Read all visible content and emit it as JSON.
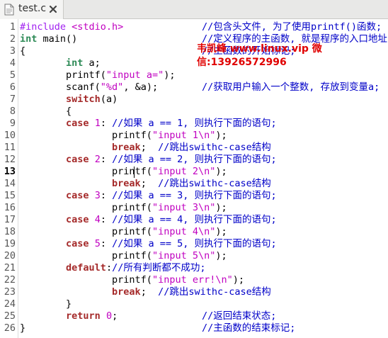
{
  "tab": {
    "filename": "test.c",
    "icon": "text-file-icon",
    "close_icon": "close-icon"
  },
  "lines": [
    {
      "n": "1",
      "code": [
        {
          "t": "#include ",
          "c": "pp"
        },
        {
          "t": "<stdio.h>",
          "c": "inc"
        }
      ],
      "comment": "//包含头文件, 为了使用printf()函数;"
    },
    {
      "n": "2",
      "code": [
        {
          "t": "int",
          "c": "type"
        },
        {
          "t": " main()",
          "c": ""
        }
      ],
      "comment": "//定义程序的主函数, 就是程序的入口地址;"
    },
    {
      "n": "3",
      "code": [
        {
          "t": "{",
          "c": ""
        }
      ],
      "comment": "//主函数的开始标记;"
    },
    {
      "n": "4",
      "code": [
        {
          "t": "        ",
          "c": ""
        },
        {
          "t": "int",
          "c": "type"
        },
        {
          "t": " a;",
          "c": ""
        }
      ],
      "comment": ""
    },
    {
      "n": "5",
      "code": [
        {
          "t": "        printf(",
          "c": ""
        },
        {
          "t": "\"input a=\"",
          "c": "str"
        },
        {
          "t": ");",
          "c": ""
        }
      ],
      "comment": ""
    },
    {
      "n": "6",
      "code": [
        {
          "t": "        scanf(",
          "c": ""
        },
        {
          "t": "\"%d\"",
          "c": "str"
        },
        {
          "t": ", &a);",
          "c": ""
        }
      ],
      "comment": "//获取用户输入一个整数, 存放到变量a;"
    },
    {
      "n": "7",
      "code": [
        {
          "t": "        ",
          "c": ""
        },
        {
          "t": "switch",
          "c": "kw"
        },
        {
          "t": "(a)",
          "c": ""
        }
      ],
      "comment": ""
    },
    {
      "n": "8",
      "code": [
        {
          "t": "        {",
          "c": ""
        }
      ],
      "comment": ""
    },
    {
      "n": "9",
      "code": [
        {
          "t": "        ",
          "c": ""
        },
        {
          "t": "case",
          "c": "kw"
        },
        {
          "t": " ",
          "c": ""
        },
        {
          "t": "1",
          "c": "num"
        },
        {
          "t": ": ",
          "c": ""
        },
        {
          "t": "//如果 a == 1, 则执行下面的语句;",
          "c": "cm"
        }
      ],
      "comment": ""
    },
    {
      "n": "10",
      "code": [
        {
          "t": "                printf(",
          "c": ""
        },
        {
          "t": "\"input 1\\n\"",
          "c": "str"
        },
        {
          "t": ");",
          "c": ""
        }
      ],
      "comment": ""
    },
    {
      "n": "11",
      "code": [
        {
          "t": "                ",
          "c": ""
        },
        {
          "t": "break",
          "c": "kw"
        },
        {
          "t": ";  ",
          "c": ""
        },
        {
          "t": "//跳出swithc-case结构",
          "c": "cm"
        }
      ],
      "comment": ""
    },
    {
      "n": "12",
      "code": [
        {
          "t": "        ",
          "c": ""
        },
        {
          "t": "case",
          "c": "kw"
        },
        {
          "t": " ",
          "c": ""
        },
        {
          "t": "2",
          "c": "num"
        },
        {
          "t": ": ",
          "c": ""
        },
        {
          "t": "//如果 a == 2, 则执行下面的语句;",
          "c": "cm"
        }
      ],
      "comment": ""
    },
    {
      "n": "13",
      "code": [
        {
          "t": "                printf(",
          "c": ""
        },
        {
          "t": "\"input 2\\n\"",
          "c": "str"
        },
        {
          "t": ");",
          "c": ""
        }
      ],
      "comment": ""
    },
    {
      "n": "14",
      "code": [
        {
          "t": "                ",
          "c": ""
        },
        {
          "t": "break",
          "c": "kw"
        },
        {
          "t": ";  ",
          "c": ""
        },
        {
          "t": "//跳出swithc-case结构",
          "c": "cm"
        }
      ],
      "comment": ""
    },
    {
      "n": "15",
      "code": [
        {
          "t": "        ",
          "c": ""
        },
        {
          "t": "case",
          "c": "kw"
        },
        {
          "t": " ",
          "c": ""
        },
        {
          "t": "3",
          "c": "num"
        },
        {
          "t": ": ",
          "c": ""
        },
        {
          "t": "//如果 a == 3, 则执行下面的语句;",
          "c": "cm"
        }
      ],
      "comment": ""
    },
    {
      "n": "16",
      "code": [
        {
          "t": "                printf(",
          "c": ""
        },
        {
          "t": "\"input 3\\n\"",
          "c": "str"
        },
        {
          "t": ");",
          "c": ""
        }
      ],
      "comment": ""
    },
    {
      "n": "17",
      "code": [
        {
          "t": "        ",
          "c": ""
        },
        {
          "t": "case",
          "c": "kw"
        },
        {
          "t": " ",
          "c": ""
        },
        {
          "t": "4",
          "c": "num"
        },
        {
          "t": ": ",
          "c": ""
        },
        {
          "t": "//如果 a == 4, 则执行下面的语句;",
          "c": "cm"
        }
      ],
      "comment": ""
    },
    {
      "n": "18",
      "code": [
        {
          "t": "                printf(",
          "c": ""
        },
        {
          "t": "\"input 4\\n\"",
          "c": "str"
        },
        {
          "t": ");",
          "c": ""
        }
      ],
      "comment": ""
    },
    {
      "n": "19",
      "code": [
        {
          "t": "        ",
          "c": ""
        },
        {
          "t": "case",
          "c": "kw"
        },
        {
          "t": " ",
          "c": ""
        },
        {
          "t": "5",
          "c": "num"
        },
        {
          "t": ": ",
          "c": ""
        },
        {
          "t": "//如果 a == 5, 则执行下面的语句;",
          "c": "cm"
        }
      ],
      "comment": ""
    },
    {
      "n": "20",
      "code": [
        {
          "t": "                printf(",
          "c": ""
        },
        {
          "t": "\"input 5\\n\"",
          "c": "str"
        },
        {
          "t": ");",
          "c": ""
        }
      ],
      "comment": ""
    },
    {
      "n": "21",
      "code": [
        {
          "t": "        ",
          "c": ""
        },
        {
          "t": "default",
          "c": "kw"
        },
        {
          "t": ":",
          "c": ""
        },
        {
          "t": "//所有判断都不成功;",
          "c": "cm"
        }
      ],
      "comment": ""
    },
    {
      "n": "22",
      "code": [
        {
          "t": "                printf(",
          "c": ""
        },
        {
          "t": "\"input err!\\n\"",
          "c": "str"
        },
        {
          "t": ");",
          "c": ""
        }
      ],
      "comment": ""
    },
    {
      "n": "23",
      "code": [
        {
          "t": "                ",
          "c": ""
        },
        {
          "t": "break",
          "c": "kw"
        },
        {
          "t": ";  ",
          "c": ""
        },
        {
          "t": "//跳出swithc-case结构",
          "c": "cm"
        }
      ],
      "comment": ""
    },
    {
      "n": "24",
      "code": [
        {
          "t": "        }",
          "c": ""
        }
      ],
      "comment": ""
    },
    {
      "n": "25",
      "code": [
        {
          "t": "        ",
          "c": ""
        },
        {
          "t": "return",
          "c": "kw"
        },
        {
          "t": " ",
          "c": ""
        },
        {
          "t": "0",
          "c": "num"
        },
        {
          "t": ";",
          "c": ""
        }
      ],
      "comment": "//返回结束状态;"
    },
    {
      "n": "26",
      "code": [
        {
          "t": "}",
          "c": ""
        }
      ],
      "comment": "//主函数的结束标记;"
    }
  ],
  "current_line": "13",
  "watermark": {
    "line1": "韦凯峰 www.linux.vip 微",
    "line2": "信:13926572996"
  },
  "colors": {
    "comment": "#0000c8",
    "keyword": "#a52a2a",
    "type": "#2e8b57",
    "string": "#c000c0",
    "watermark": "#e00000"
  }
}
